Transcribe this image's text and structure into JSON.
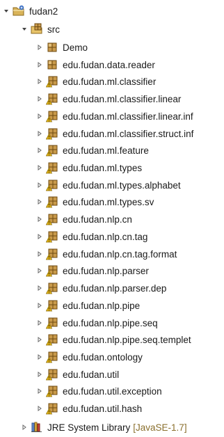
{
  "tree": {
    "project": {
      "label": "fudan2",
      "expanded": true
    },
    "src": {
      "label": "src",
      "expanded": true
    },
    "packages": [
      {
        "label": "Demo",
        "icon": "package-icon"
      },
      {
        "label": "edu.fudan.data.reader",
        "icon": "package-icon"
      },
      {
        "label": "edu.fudan.ml.classifier",
        "icon": "package-warning-icon"
      },
      {
        "label": "edu.fudan.ml.classifier.linear",
        "icon": "package-warning-icon"
      },
      {
        "label": "edu.fudan.ml.classifier.linear.inf",
        "icon": "package-warning-icon"
      },
      {
        "label": "edu.fudan.ml.classifier.struct.inf",
        "icon": "package-warning-icon"
      },
      {
        "label": "edu.fudan.ml.feature",
        "icon": "package-warning-icon"
      },
      {
        "label": "edu.fudan.ml.types",
        "icon": "package-warning-icon"
      },
      {
        "label": "edu.fudan.ml.types.alphabet",
        "icon": "package-warning-icon"
      },
      {
        "label": "edu.fudan.ml.types.sv",
        "icon": "package-warning-icon"
      },
      {
        "label": "edu.fudan.nlp.cn",
        "icon": "package-warning-icon"
      },
      {
        "label": "edu.fudan.nlp.cn.tag",
        "icon": "package-warning-icon"
      },
      {
        "label": "edu.fudan.nlp.cn.tag.format",
        "icon": "package-warning-icon"
      },
      {
        "label": "edu.fudan.nlp.parser",
        "icon": "package-warning-icon"
      },
      {
        "label": "edu.fudan.nlp.parser.dep",
        "icon": "package-warning-icon"
      },
      {
        "label": "edu.fudan.nlp.pipe",
        "icon": "package-warning-icon"
      },
      {
        "label": "edu.fudan.nlp.pipe.seq",
        "icon": "package-warning-icon"
      },
      {
        "label": "edu.fudan.nlp.pipe.seq.templet",
        "icon": "package-warning-icon"
      },
      {
        "label": "edu.fudan.ontology",
        "icon": "package-warning-icon"
      },
      {
        "label": "edu.fudan.util",
        "icon": "package-warning-icon"
      },
      {
        "label": "edu.fudan.util.exception",
        "icon": "package-warning-icon"
      },
      {
        "label": "edu.fudan.util.hash",
        "icon": "package-warning-icon"
      }
    ],
    "library": {
      "label": "JRE System Library",
      "suffix": "[JavaSE-1.7]"
    }
  }
}
